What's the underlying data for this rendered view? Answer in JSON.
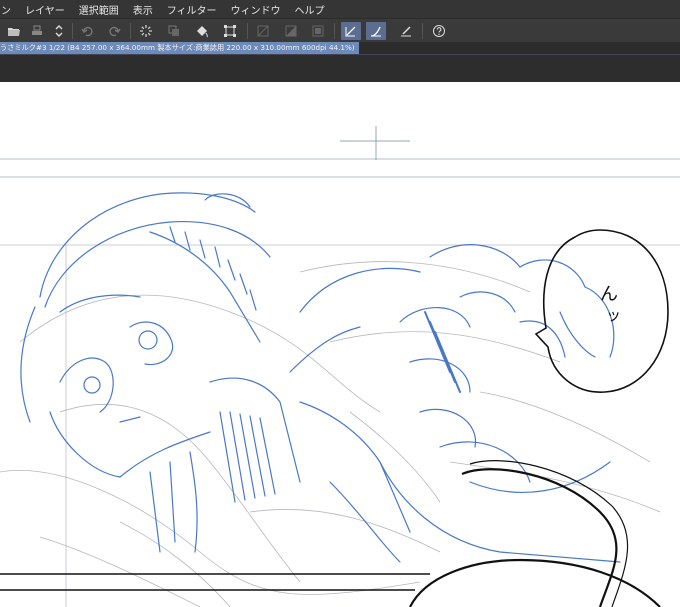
{
  "menu": {
    "items": [
      "ン",
      "レイヤー",
      "選択範囲",
      "表示",
      "フィルター",
      "ウィンドウ",
      "ヘルプ"
    ]
  },
  "toolbar": {
    "icons": [
      "open-folder-icon",
      "print-icon",
      "sort-icon",
      "undo-icon",
      "redo-icon",
      "loading-icon",
      "copy-layer-icon",
      "fill-icon",
      "transform-icon",
      "ruler-off-icon",
      "ruler-half-icon",
      "frame-icon",
      "pen-correction-icon",
      "brush-correction-icon",
      "eraser-icon",
      "help-icon"
    ]
  },
  "document_tab": {
    "label": "うさミルク#3 1/22 (B4 257.00 x 364.00mm 製本サイズ:商業誌用 220.00 x 310.00mm 600dpi 44.1%)"
  },
  "balloon": {
    "text_line1": "ん",
    "text_line2": "ッ"
  },
  "colors": {
    "sketch_blue": "#4a78c8",
    "sketch_gray": "#9aa0a8",
    "menubar_bg": "#353535",
    "toolbar_bg": "#3a3a3a",
    "tab_bg": "#6d8ab8",
    "active_tool_bg": "#5b6e92"
  }
}
